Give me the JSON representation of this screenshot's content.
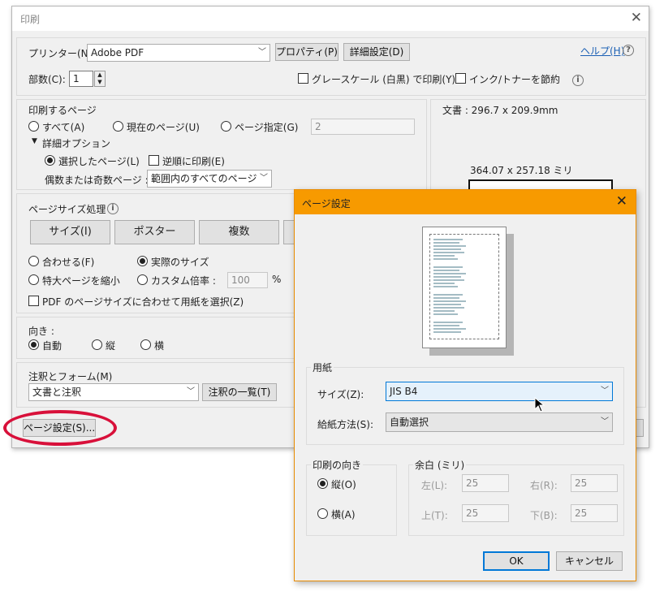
{
  "print_dialog": {
    "title": "印刷",
    "printer_label": "プリンター(N):",
    "printer_value": "Adobe PDF",
    "properties_button": "プロパティ(P)",
    "advanced_button": "詳細設定(D)",
    "help_link": "ヘルプ(H)",
    "copies_label": "部数(C):",
    "copies_value": "1",
    "grayscale_label": "グレースケール (白黒) で印刷(Y)",
    "save_ink_label": "インク/トナーを節約",
    "pages_section": {
      "title": "印刷するページ",
      "all": "すべて(A)",
      "current": "現在のページ(U)",
      "range": "ページ指定(G)",
      "range_value": "2",
      "more_options": "詳細オプション",
      "selected_pages": "選択したページ(L)",
      "reverse": "逆順に印刷(E)",
      "odd_even_label": "偶数または奇数ページ :",
      "odd_even_value": "範囲内のすべてのページ"
    },
    "size_section": {
      "title": "ページサイズ処理",
      "size_button": "サイズ(I)",
      "poster_button": "ポスター",
      "multiple_button": "複数",
      "fit": "合わせる(F)",
      "actual": "実際のサイズ",
      "shrink": "特大ページを縮小",
      "custom": "カスタム倍率 :",
      "custom_value": "100",
      "percent": "%",
      "pdf_paper": "PDF のページサイズに合わせて用紙を選択(Z)"
    },
    "orientation_section": {
      "title": "向き :",
      "auto": "自動",
      "portrait": "縦",
      "landscape": "横"
    },
    "annotations_section": {
      "title": "注釈とフォーム(M)",
      "value": "文書と注釈",
      "summary_button": "注釈の一覧(T)"
    },
    "page_setup_button": "ページ設定(S)...",
    "document_size": "文書 : 296.7 x 209.9mm",
    "preview_size": "364.07 x 257.18 ミリ"
  },
  "page_setup_dialog": {
    "title": "ページ設定",
    "paper_group": "用紙",
    "size_label": "サイズ(Z):",
    "size_value": "JIS B4",
    "source_label": "給紙方法(S):",
    "source_value": "自動選択",
    "orientation_group": "印刷の向き",
    "portrait": "縦(O)",
    "landscape": "横(A)",
    "margins_group": "余白 (ミリ)",
    "left_label": "左(L):",
    "left_value": "25",
    "right_label": "右(R):",
    "right_value": "25",
    "top_label": "上(T):",
    "top_value": "25",
    "bottom_label": "下(B):",
    "bottom_value": "25",
    "ok_button": "OK",
    "cancel_button": "キャンセル"
  },
  "colors": {
    "accent_title": "#f79a00",
    "highlight_ring": "#d8103a",
    "link": "#1a5fb4"
  }
}
